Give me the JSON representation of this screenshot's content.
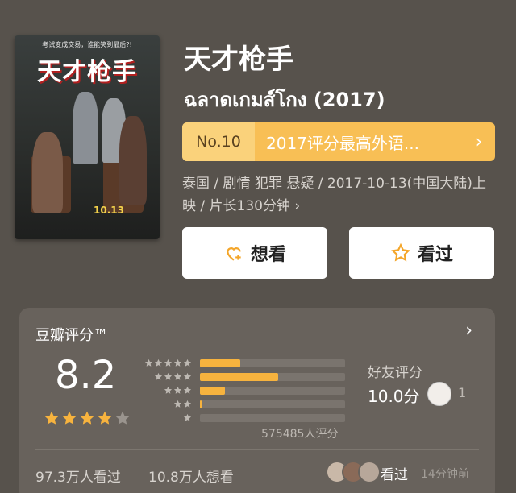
{
  "poster": {
    "tagline": "考试变成交易，谁能笑到最后?!",
    "title": "天才枪手",
    "date": "10.13"
  },
  "movie": {
    "title_cn": "天才枪手",
    "title_original": "ฉลาดเกมส์โกง (2017)",
    "rank_no": "No.10",
    "rank_text": "2017评分最高外语...",
    "meta": "泰国 / 剧情 犯罪 悬疑 / 2017-10-13(中国大陆)上映 / 片长130分钟 ›"
  },
  "actions": {
    "want_label": "想看",
    "seen_label": "看过"
  },
  "rating": {
    "label": "豆瓣评分™",
    "score": "8.2",
    "stars": 4,
    "distribution": [
      0.28,
      0.54,
      0.17,
      0.01,
      0.0
    ],
    "count": "575485人评分",
    "friend_label": "好友评分",
    "friend_score": "10.0分",
    "friend_count": "1"
  },
  "stats": {
    "watched": "97.3万人看过",
    "wish": "10.8万人想看",
    "seen_label": "看过",
    "seen_ago": "14分钟前"
  },
  "colors": {
    "background": "#57524c",
    "accent": "#f8bf55",
    "star": "#f7b33e"
  }
}
